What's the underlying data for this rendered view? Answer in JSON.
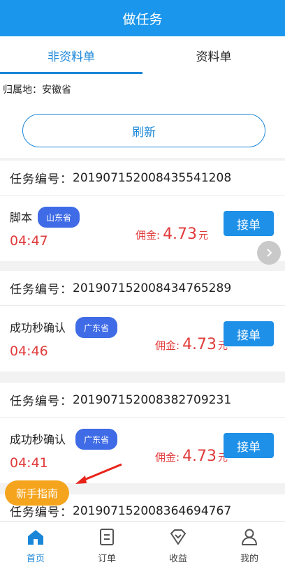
{
  "header": {
    "title": "做任务"
  },
  "tabs": [
    {
      "label": "非资料单",
      "active": true
    },
    {
      "label": "资料单",
      "active": false
    }
  ],
  "region": {
    "text": "归属地：安徽省"
  },
  "refresh": {
    "label": "刷新"
  },
  "tasks": [
    {
      "id_label": "任务编号：",
      "id": "2019071520084355412​08",
      "name": "脚本",
      "province": "山东省",
      "countdown": "04:47",
      "commission_label": "佣金:",
      "commission": "4.73",
      "unit": "元",
      "accept": "接单"
    },
    {
      "id_label": "任务编号：",
      "id": "2019071520084347652​89",
      "name": "成功秒确认",
      "province": "广东省",
      "countdown": "04:46",
      "commission_label": "佣金:",
      "commission": "4.73",
      "unit": "元",
      "accept": "接单"
    },
    {
      "id_label": "任务编号：",
      "id": "2019071520083827092​31",
      "name": "成功秒确认",
      "province": "广东省",
      "countdown": "04:41",
      "commission_label": "佣金:",
      "commission": "4.73",
      "unit": "元",
      "accept": "接单"
    },
    {
      "id_label": "任务编号：",
      "id": "2019071520083646947​67"
    }
  ],
  "guide": {
    "label": "新手指南"
  },
  "nav": [
    {
      "label": "首页",
      "icon": "home-icon",
      "active": true
    },
    {
      "label": "订单",
      "icon": "order-icon",
      "active": false
    },
    {
      "label": "收益",
      "icon": "earnings-icon",
      "active": false
    },
    {
      "label": "我的",
      "icon": "profile-icon",
      "active": false
    }
  ],
  "colors": {
    "primary": "#1a96ec",
    "accent_red": "#e03b3b",
    "badge_blue": "#3f6be6",
    "guide_orange": "#f5a41e",
    "annotation_red": "#e8231a"
  }
}
